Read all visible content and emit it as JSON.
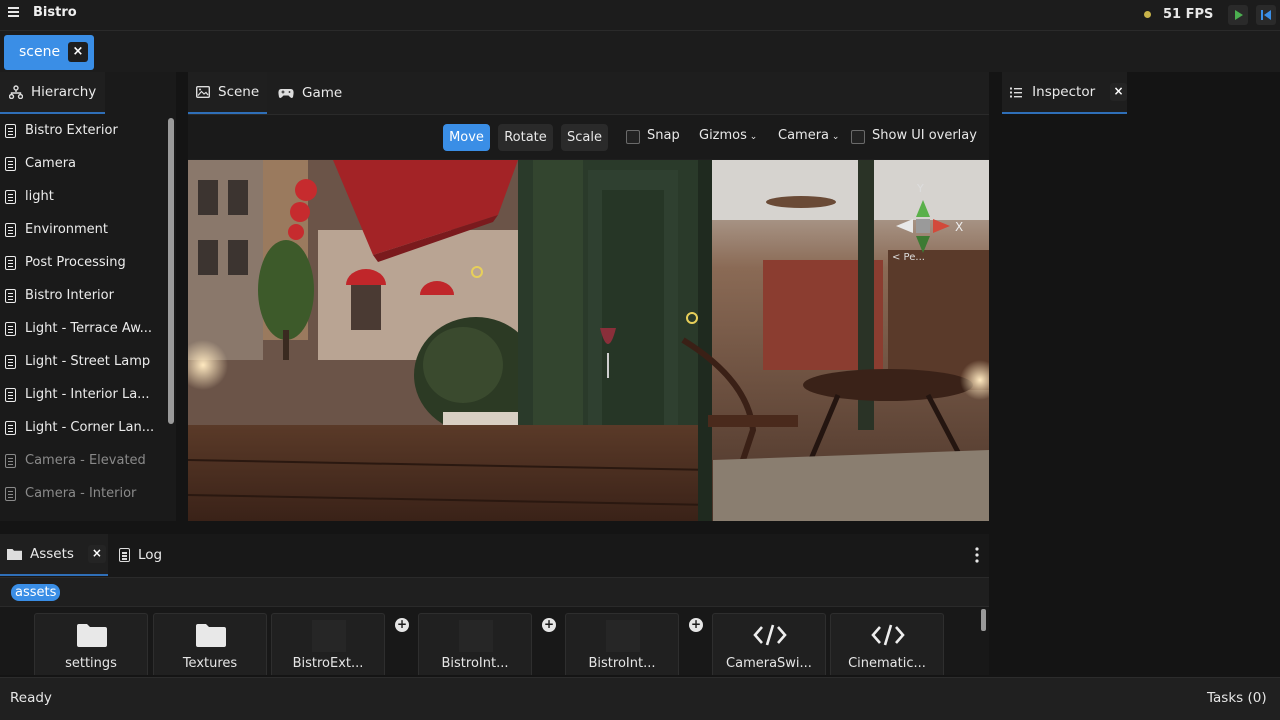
{
  "app": {
    "title": "Bistro",
    "fps": "51 FPS"
  },
  "document_tab": {
    "label": "scene",
    "close": "×"
  },
  "hierarchy": {
    "tab_label": "Hierarchy",
    "items": [
      {
        "label": "Bistro Exterior"
      },
      {
        "label": "Camera"
      },
      {
        "label": "light"
      },
      {
        "label": "Environment"
      },
      {
        "label": "Post Processing"
      },
      {
        "label": "Bistro Interior"
      },
      {
        "label": "Light - Terrace Aw..."
      },
      {
        "label": "Light - Street Lamp"
      },
      {
        "label": "Light - Interior La..."
      },
      {
        "label": "Light - Corner Lan..."
      },
      {
        "label": "Camera - Elevated"
      },
      {
        "label": "Camera - Interior"
      }
    ]
  },
  "viewport": {
    "tabs": [
      {
        "label": "Scene"
      },
      {
        "label": "Game"
      }
    ],
    "toolbar": {
      "move": "Move",
      "rotate": "Rotate",
      "scale": "Scale",
      "snap": "Snap",
      "gizmos": "Gizmos",
      "camera": "Camera",
      "show_ui_overlay": "Show UI overlay"
    },
    "gizmo_axes": {
      "y": "Y",
      "x": "X",
      "persp": "< Pe..."
    }
  },
  "inspector": {
    "tab_label": "Inspector",
    "close": "×"
  },
  "assets": {
    "tab_label": "Assets",
    "log_label": "Log",
    "close": "×",
    "path": "assets",
    "items": [
      {
        "label": "settings",
        "icon": "folder-icon"
      },
      {
        "label": "Textures",
        "icon": "folder-icon"
      },
      {
        "label": "BistroExt...",
        "icon": "model-thumb"
      },
      {
        "label": "BistroInt...",
        "icon": "model-thumb"
      },
      {
        "label": "BistroInt...",
        "icon": "model-thumb"
      },
      {
        "label": "CameraSwi...",
        "icon": "code-icon"
      },
      {
        "label": "Cinematic...",
        "icon": "code-icon"
      }
    ]
  },
  "status": {
    "text": "Ready",
    "tasks": "Tasks (0)"
  },
  "colors": {
    "accent": "#3a8ee6",
    "fps_dot": "#c8b34a",
    "play": "#4caf50",
    "step": "#3a8ee6"
  }
}
